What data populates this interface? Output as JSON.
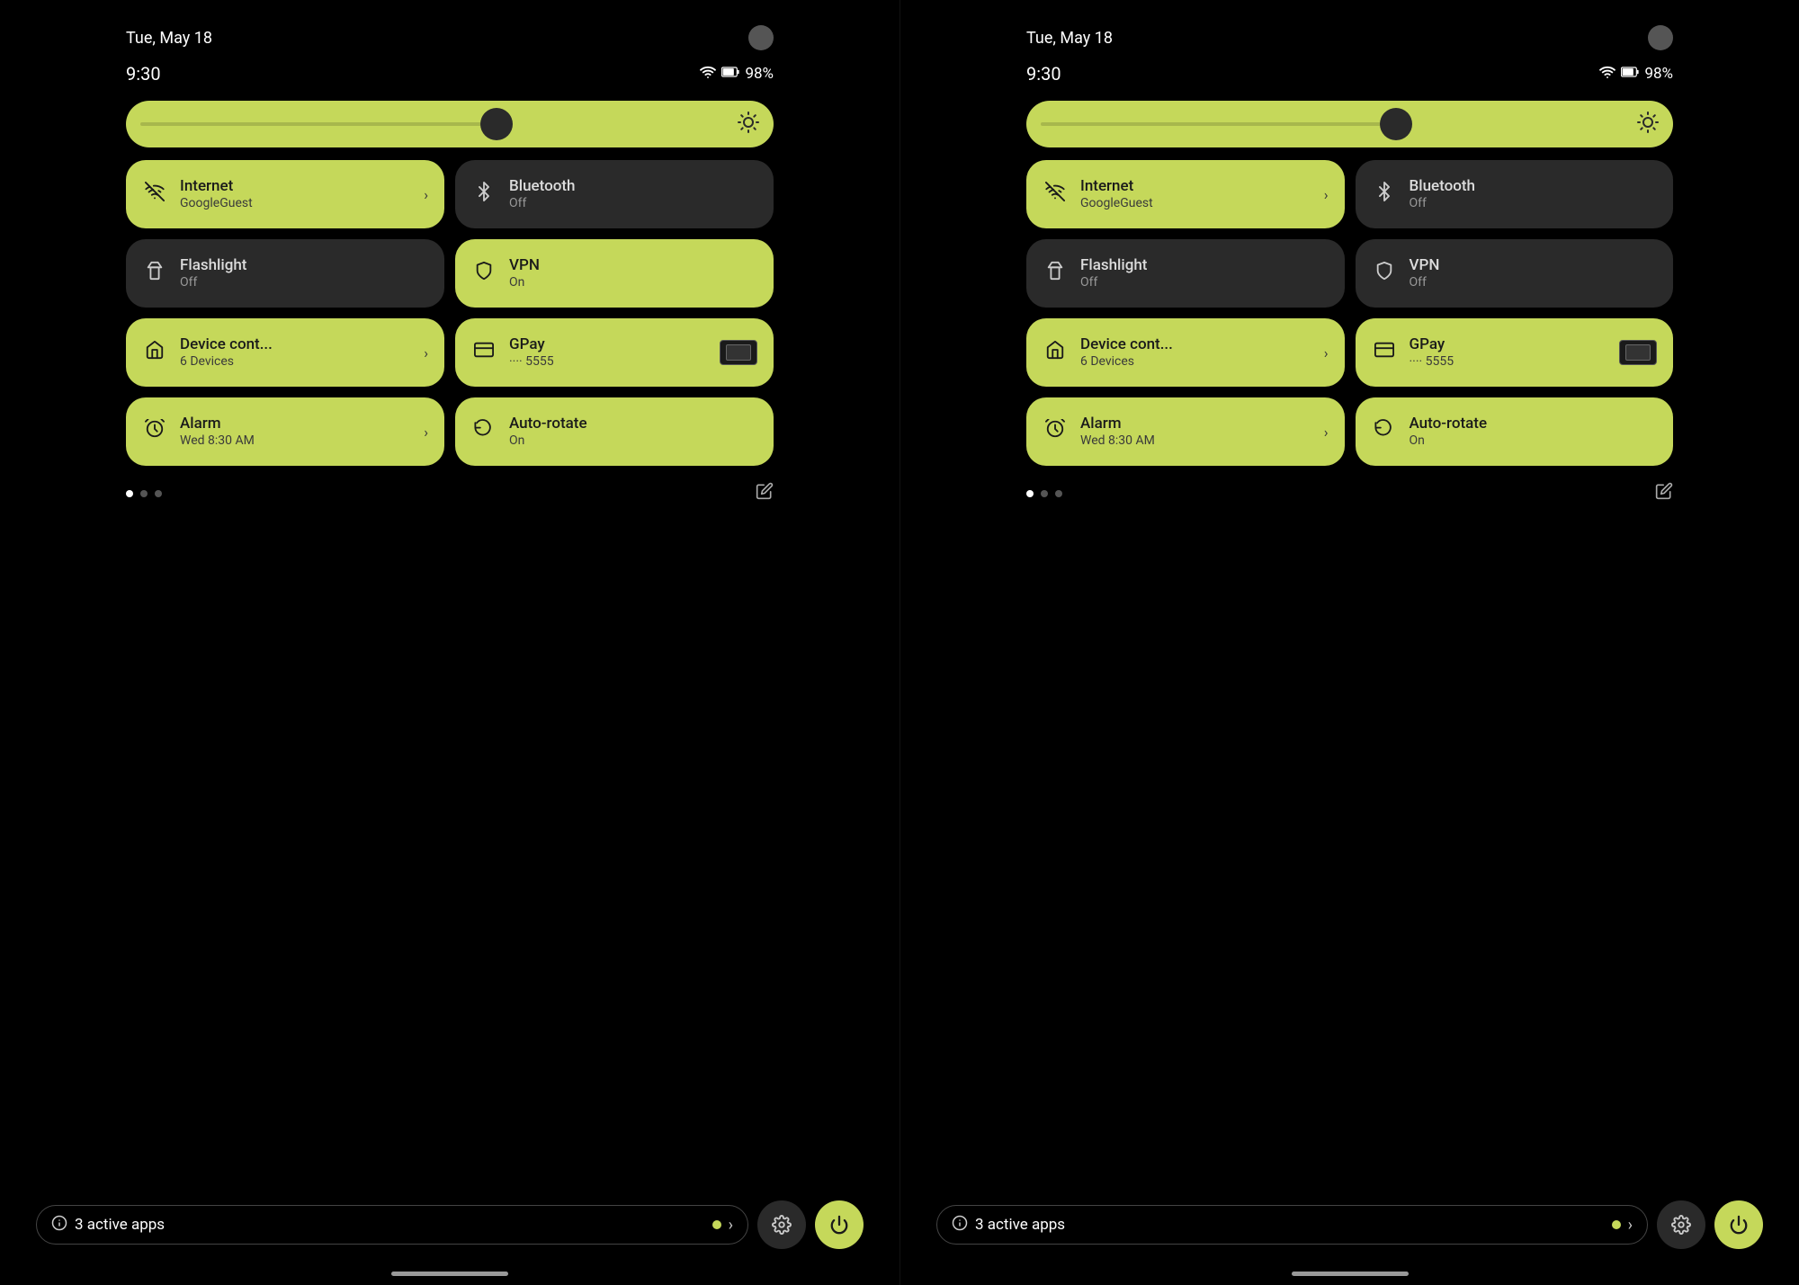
{
  "panels": [
    {
      "id": "panel-left",
      "status": {
        "date": "Tue, May 18",
        "time": "9:30",
        "battery": "98%"
      },
      "brightness": {
        "icon": "⚙"
      },
      "tiles": [
        {
          "id": "internet",
          "icon": "▾",
          "iconSymbol": "wifi",
          "title": "Internet",
          "subtitle": "GoogleGuest",
          "active": true,
          "hasArrow": true,
          "arrowLabel": "›"
        },
        {
          "id": "bluetooth",
          "icon": "✦",
          "iconSymbol": "bluetooth",
          "title": "Bluetooth",
          "subtitle": "Off",
          "active": false,
          "hasArrow": false
        },
        {
          "id": "flashlight",
          "icon": "▮",
          "iconSymbol": "flashlight",
          "title": "Flashlight",
          "subtitle": "Off",
          "active": false,
          "hasArrow": false
        },
        {
          "id": "vpn",
          "icon": "◉",
          "iconSymbol": "vpn",
          "title": "VPN",
          "subtitle": "On",
          "active": true,
          "hasArrow": false
        },
        {
          "id": "device-control",
          "icon": "⌂",
          "iconSymbol": "home",
          "title": "Device cont...",
          "subtitle": "6 Devices",
          "active": true,
          "hasArrow": true,
          "arrowLabel": "›"
        },
        {
          "id": "gpay",
          "icon": "▬",
          "iconSymbol": "card",
          "title": "GPay",
          "subtitle": "···· 5555",
          "active": true,
          "hasArrow": false,
          "hasCard": true
        },
        {
          "id": "alarm",
          "icon": "◷",
          "iconSymbol": "alarm",
          "title": "Alarm",
          "subtitle": "Wed 8:30 AM",
          "active": true,
          "hasArrow": true,
          "arrowLabel": "›"
        },
        {
          "id": "autorotate",
          "icon": "↻",
          "iconSymbol": "rotate",
          "title": "Auto-rotate",
          "subtitle": "On",
          "active": true,
          "hasArrow": false
        }
      ],
      "pagination": {
        "active": 0,
        "total": 3
      },
      "bottom": {
        "appsCount": "3",
        "appsLabel": "active apps"
      }
    },
    {
      "id": "panel-right",
      "status": {
        "date": "Tue, May 18",
        "time": "9:30",
        "battery": "98%"
      },
      "brightness": {
        "icon": "⚙"
      },
      "tiles": [
        {
          "id": "internet",
          "icon": "▾",
          "iconSymbol": "wifi",
          "title": "Internet",
          "subtitle": "GoogleGuest",
          "active": true,
          "hasArrow": true,
          "arrowLabel": "›"
        },
        {
          "id": "bluetooth",
          "icon": "✦",
          "iconSymbol": "bluetooth",
          "title": "Bluetooth",
          "subtitle": "Off",
          "active": false,
          "hasArrow": false
        },
        {
          "id": "flashlight",
          "icon": "▮",
          "iconSymbol": "flashlight",
          "title": "Flashlight",
          "subtitle": "Off",
          "active": false,
          "hasArrow": false
        },
        {
          "id": "vpn",
          "icon": "◉",
          "iconSymbol": "vpn",
          "title": "VPN",
          "subtitle": "Off",
          "active": false,
          "hasArrow": false
        },
        {
          "id": "device-control",
          "icon": "⌂",
          "iconSymbol": "home",
          "title": "Device cont...",
          "subtitle": "6 Devices",
          "active": true,
          "hasArrow": true,
          "arrowLabel": "›"
        },
        {
          "id": "gpay",
          "icon": "▬",
          "iconSymbol": "card",
          "title": "GPay",
          "subtitle": "···· 5555",
          "active": true,
          "hasArrow": false,
          "hasCard": true
        },
        {
          "id": "alarm",
          "icon": "◷",
          "iconSymbol": "alarm",
          "title": "Alarm",
          "subtitle": "Wed 8:30 AM",
          "active": true,
          "hasArrow": true,
          "arrowLabel": "›"
        },
        {
          "id": "autorotate",
          "icon": "↻",
          "iconSymbol": "rotate",
          "title": "Auto-rotate",
          "subtitle": "On",
          "active": true,
          "hasArrow": false
        }
      ],
      "pagination": {
        "active": 0,
        "total": 3
      },
      "bottom": {
        "appsCount": "3",
        "appsLabel": "active apps"
      }
    }
  ],
  "colors": {
    "active": "#c5d85a",
    "inactive": "#2a2a2a",
    "background": "#000000"
  }
}
